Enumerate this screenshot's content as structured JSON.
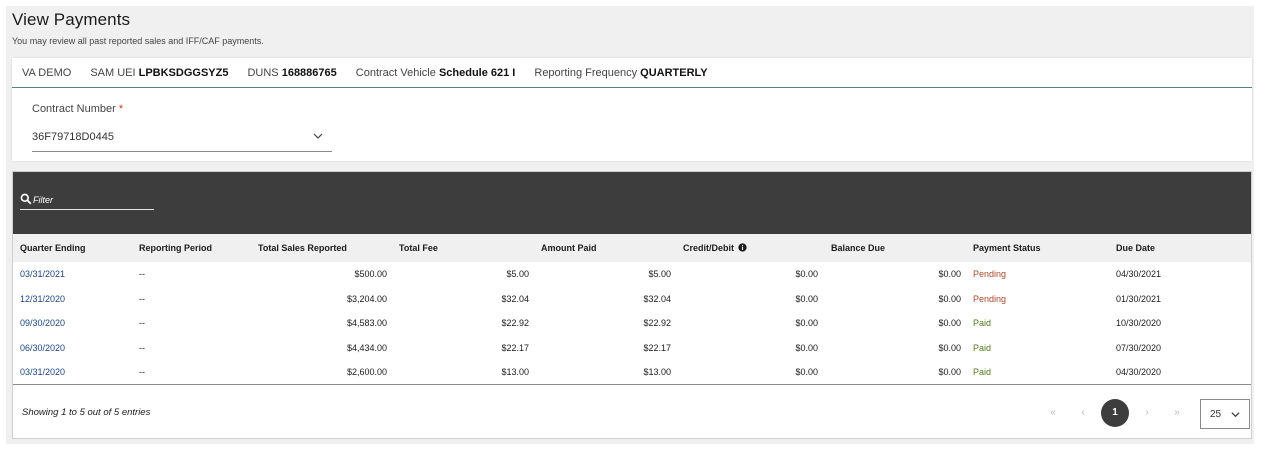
{
  "page": {
    "title": "View Payments",
    "subtitle": "You may review all past reported sales and IFF/CAF payments."
  },
  "info": {
    "company": "VA DEMO",
    "sam_uei_label": "SAM UEI",
    "sam_uei_value": "LPBKSDGGSYZ5",
    "duns_label": "DUNS",
    "duns_value": "168886765",
    "vehicle_label": "Contract Vehicle",
    "vehicle_value": "Schedule 621 I",
    "frequency_label": "Reporting Frequency",
    "frequency_value": "QUARTERLY"
  },
  "contract": {
    "label": "Contract Number",
    "required_mark": "*",
    "value": "36F79718D0445"
  },
  "filter": {
    "placeholder": "Filter"
  },
  "table": {
    "columns": {
      "quarter_ending": "Quarter Ending",
      "reporting_period": "Reporting Period",
      "total_sales": "Total Sales Reported",
      "total_fee": "Total Fee",
      "amount_paid": "Amount Paid",
      "credit_debit": "Credit/Debit",
      "balance_due": "Balance Due",
      "payment_status": "Payment Status",
      "due_date": "Due Date"
    },
    "rows": [
      {
        "quarter": "03/31/2021",
        "period": "--",
        "sales": "$500.00",
        "fee": "$5.00",
        "paid": "$5.00",
        "credit": "$0.00",
        "balance": "$0.00",
        "status": "Pending",
        "due": "04/30/2021"
      },
      {
        "quarter": "12/31/2020",
        "period": "--",
        "sales": "$3,204.00",
        "fee": "$32.04",
        "paid": "$32.04",
        "credit": "$0.00",
        "balance": "$0.00",
        "status": "Pending",
        "due": "01/30/2021"
      },
      {
        "quarter": "09/30/2020",
        "period": "--",
        "sales": "$4,583.00",
        "fee": "$22.92",
        "paid": "$22.92",
        "credit": "$0.00",
        "balance": "$0.00",
        "status": "Paid",
        "due": "10/30/2020"
      },
      {
        "quarter": "06/30/2020",
        "period": "--",
        "sales": "$4,434.00",
        "fee": "$22.17",
        "paid": "$22.17",
        "credit": "$0.00",
        "balance": "$0.00",
        "status": "Paid",
        "due": "07/30/2020"
      },
      {
        "quarter": "03/31/2020",
        "period": "--",
        "sales": "$2,600.00",
        "fee": "$13.00",
        "paid": "$13.00",
        "credit": "$0.00",
        "balance": "$0.00",
        "status": "Paid",
        "due": "04/30/2020"
      }
    ]
  },
  "footer": {
    "showing": "Showing 1 to 5 out of 5 entries",
    "first": "«",
    "prev": "‹",
    "current_page": "1",
    "next": "›",
    "last": "»",
    "page_size": "25"
  },
  "colors": {
    "link": "#1a4480",
    "pending": "#a94a2c",
    "paid": "#4f7a1e",
    "dark_bar": "#3d3d3d"
  },
  "icons": {
    "filter": "search-icon",
    "contract_dropdown": "chevron-down-icon",
    "credit_info": "info-icon",
    "page_size_dropdown": "chevron-down-icon"
  }
}
